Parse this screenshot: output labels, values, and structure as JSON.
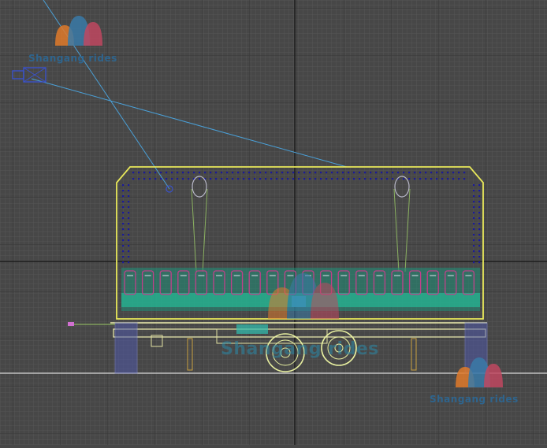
{
  "viewport": {
    "background": "#474747",
    "grid_minor_color": "#5a5a5a",
    "grid_major_color": "#2a2a2a",
    "wire_colors": {
      "frame": "#e8e85a",
      "dots": "#1a1a9a",
      "seats": "#c0408a",
      "green": "#2aa080",
      "camera": "#4aa0d8",
      "chassis": "#f0f0b0",
      "wheels": "#e8f0a0",
      "blue_parts": "#6060d0"
    }
  },
  "watermarks": [
    {
      "text": "Shangang rides",
      "icon": "shangang-logo-icon"
    },
    {
      "text": "Shangang rides",
      "icon": "shangang-logo-icon"
    },
    {
      "text": "Shangang rides",
      "icon": "shangang-logo-icon"
    }
  ]
}
